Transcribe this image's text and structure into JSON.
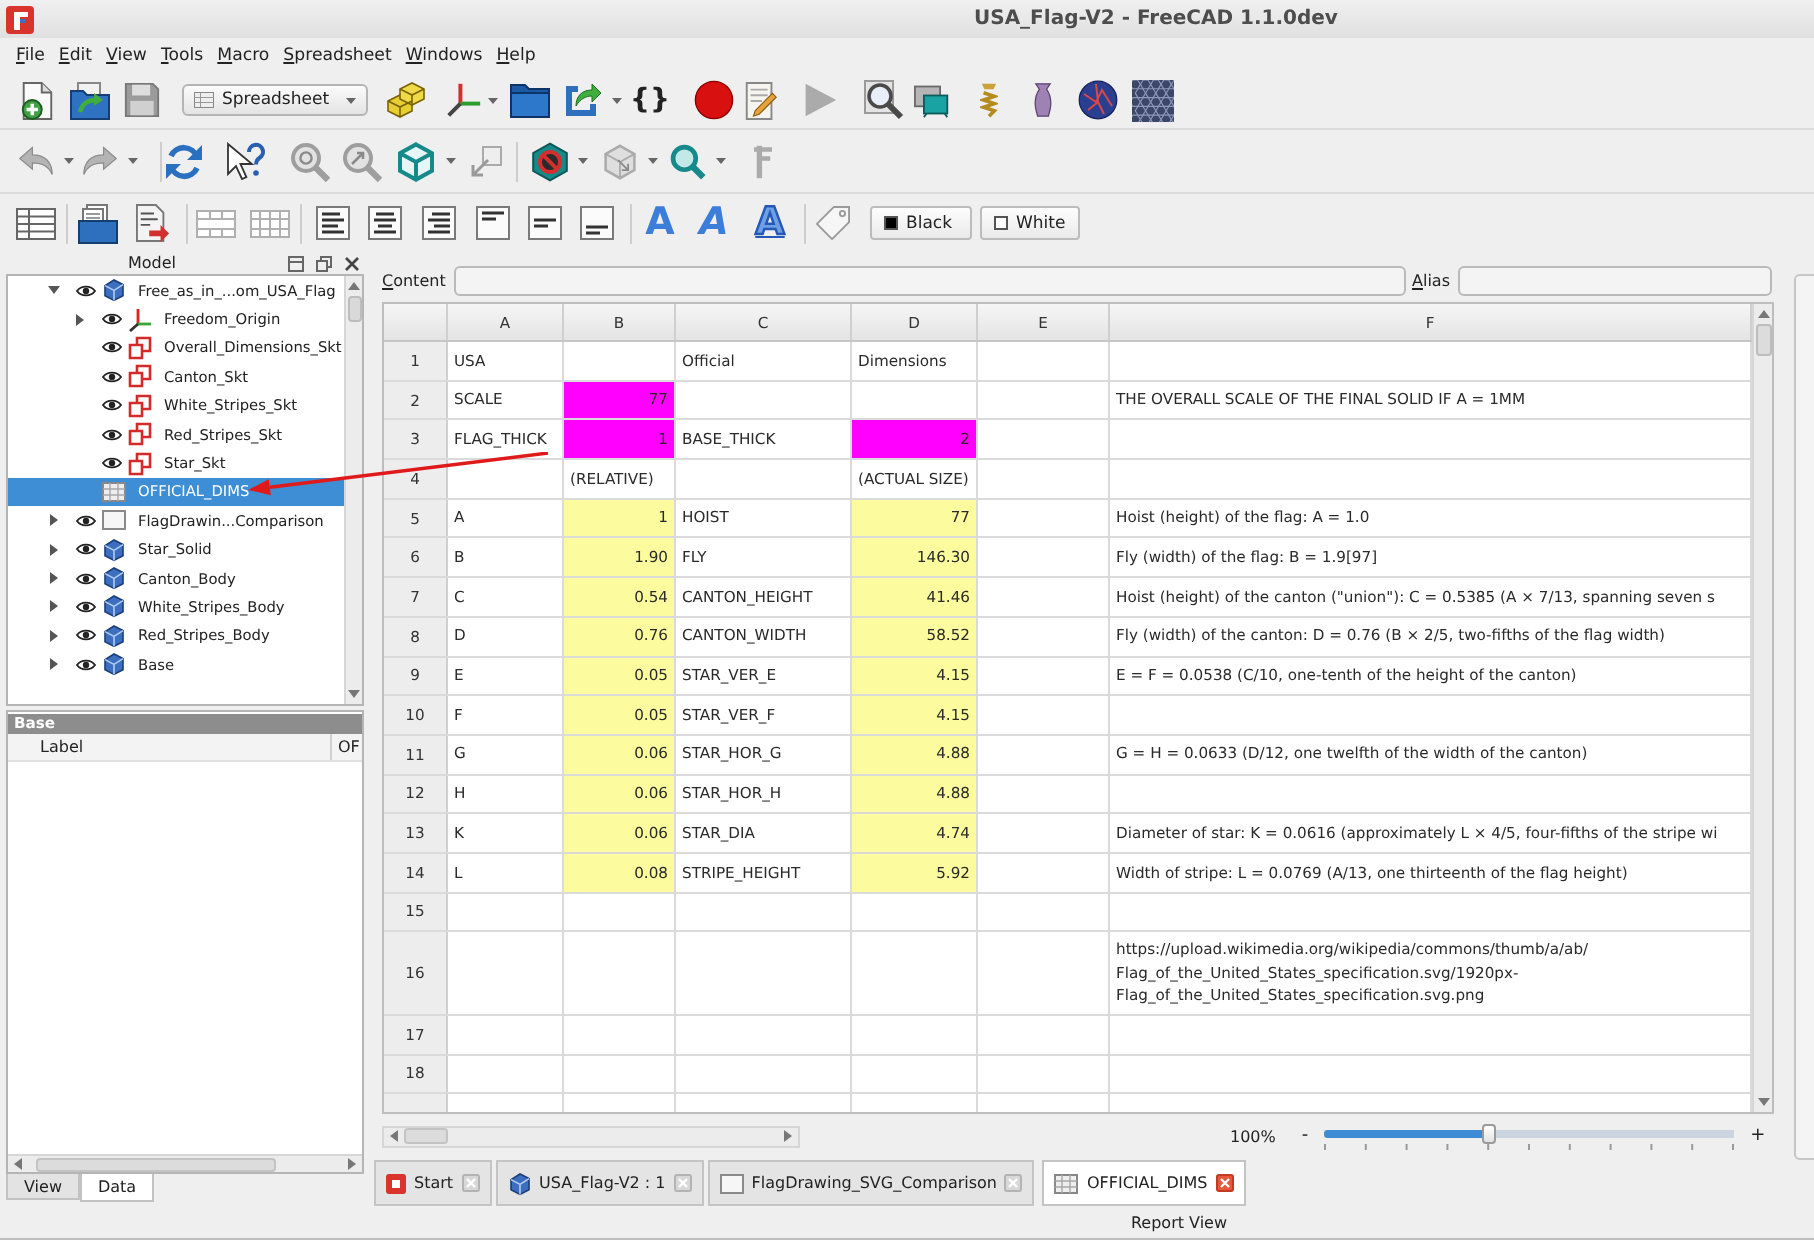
{
  "window": {
    "title": "USA_Flag-V2 - FreeCAD 1.1.0dev"
  },
  "menu_bar": [
    "File",
    "Edit",
    "View",
    "Tools",
    "Macro",
    "Spreadsheet",
    "Windows",
    "Help"
  ],
  "toolbar": {
    "workbench": "Spreadsheet",
    "braces_button": "{}",
    "format_buttons": [
      {
        "glyph": "A",
        "kind": "bold"
      },
      {
        "glyph": "A",
        "kind": "italic"
      },
      {
        "glyph": "A",
        "kind": "underline"
      }
    ],
    "color_buttons": [
      {
        "label": "Black",
        "color": "#000000"
      },
      {
        "label": "White",
        "color": "#ffffff"
      }
    ]
  },
  "model_panel": {
    "title": "Model",
    "tree": [
      {
        "label": "Free_as_in_...om_USA_Flag",
        "kind": "body",
        "visible": true,
        "expanded": true,
        "selected": false,
        "children": [
          {
            "label": "Freedom_Origin",
            "kind": "origin",
            "visible": true,
            "expanded": false,
            "selected": false
          },
          {
            "label": "Overall_Dimensions_Skt",
            "kind": "sketch",
            "visible": true,
            "selected": false
          },
          {
            "label": "Canton_Skt",
            "kind": "sketch",
            "visible": true,
            "selected": false
          },
          {
            "label": "White_Stripes_Skt",
            "kind": "sketch",
            "visible": true,
            "selected": false
          },
          {
            "label": "Red_Stripes_Skt",
            "kind": "sketch",
            "visible": true,
            "selected": false
          },
          {
            "label": "Star_Skt",
            "kind": "sketch",
            "visible": true,
            "selected": false
          },
          {
            "label": "OFFICIAL_DIMS",
            "kind": "spreadsheet",
            "visible": false,
            "selected": true
          }
        ]
      },
      {
        "label": "FlagDrawin...Comparison",
        "kind": "page",
        "visible": true,
        "expanded": false,
        "selected": false
      },
      {
        "label": "Star_Solid",
        "kind": "body",
        "visible": true,
        "expanded": false,
        "selected": false
      },
      {
        "label": "Canton_Body",
        "kind": "body",
        "visible": true,
        "expanded": false,
        "selected": false
      },
      {
        "label": "White_Stripes_Body",
        "kind": "body",
        "visible": true,
        "expanded": false,
        "selected": false
      },
      {
        "label": "Red_Stripes_Body",
        "kind": "body",
        "visible": true,
        "expanded": false,
        "selected": false
      },
      {
        "label": "Base",
        "kind": "body",
        "visible": true,
        "expanded": false,
        "selected": false
      }
    ]
  },
  "property_panel": {
    "group": "Base",
    "properties": [
      {
        "name": "Label",
        "value": "OF"
      }
    ],
    "tabs": [
      {
        "label": "View",
        "selected": false
      },
      {
        "label": "Data",
        "selected": true
      }
    ]
  },
  "spreadsheet": {
    "content_label": "Content",
    "alias_label": "Alias",
    "columns": [
      "A",
      "B",
      "C",
      "D",
      "E",
      "F"
    ],
    "rows": [
      {
        "header": "1",
        "cells": [
          {
            "text": "USA",
            "kind": "text"
          },
          null,
          {
            "text": "Official",
            "kind": "text"
          },
          {
            "text": "Dimensions",
            "kind": "text"
          },
          null,
          null
        ]
      },
      {
        "header": "2",
        "cells": [
          {
            "text": "SCALE",
            "kind": "text"
          },
          {
            "text": "77",
            "kind": "number",
            "color": "#ff00ff"
          },
          null,
          null,
          null,
          {
            "text": "THE OVERALL SCALE OF THE FINAL SOLID IF A = 1MM",
            "kind": "text"
          }
        ]
      },
      {
        "header": "3",
        "cells": [
          {
            "text": "FLAG_THICK",
            "kind": "text"
          },
          {
            "text": "1",
            "kind": "number",
            "color": "#ff00ff"
          },
          {
            "text": "BASE_THICK",
            "kind": "text"
          },
          {
            "text": "2",
            "kind": "number",
            "color": "#ff00ff"
          },
          null,
          null
        ]
      },
      {
        "header": "4",
        "cells": [
          null,
          {
            "text": "(RELATIVE)",
            "kind": "text"
          },
          null,
          {
            "text": "(ACTUAL SIZE)",
            "kind": "text"
          },
          null,
          null
        ]
      },
      {
        "header": "5",
        "cells": [
          {
            "text": "A",
            "kind": "text"
          },
          {
            "text": "1",
            "kind": "number",
            "color": "#fcfc9e"
          },
          {
            "text": "HOIST",
            "kind": "text"
          },
          {
            "text": "77",
            "kind": "number",
            "color": "#fcfc9e"
          },
          null,
          {
            "text": "Hoist (height) of the flag: A = 1.0",
            "kind": "text"
          }
        ]
      },
      {
        "header": "6",
        "cells": [
          {
            "text": "B",
            "kind": "text"
          },
          {
            "text": "1.90",
            "kind": "number",
            "color": "#fcfc9e"
          },
          {
            "text": "FLY",
            "kind": "text"
          },
          {
            "text": "146.30",
            "kind": "number",
            "color": "#fcfc9e"
          },
          null,
          {
            "text": "Fly (width) of the flag: B = 1.9[97]",
            "kind": "text"
          }
        ]
      },
      {
        "header": "7",
        "cells": [
          {
            "text": "C",
            "kind": "text"
          },
          {
            "text": "0.54",
            "kind": "number",
            "color": "#fcfc9e"
          },
          {
            "text": "CANTON_HEIGHT",
            "kind": "text"
          },
          {
            "text": "41.46",
            "kind": "number",
            "color": "#fcfc9e"
          },
          null,
          {
            "text": "Hoist (height) of the canton (\"union\"): C = 0.5385 (A × 7/13, spanning seven s",
            "kind": "text"
          }
        ]
      },
      {
        "header": "8",
        "cells": [
          {
            "text": "D",
            "kind": "text"
          },
          {
            "text": "0.76",
            "kind": "number",
            "color": "#fcfc9e"
          },
          {
            "text": "CANTON_WIDTH",
            "kind": "text"
          },
          {
            "text": "58.52",
            "kind": "number",
            "color": "#fcfc9e"
          },
          null,
          {
            "text": "Fly (width) of the canton: D = 0.76 (B × 2/5, two-fifths of the flag width)",
            "kind": "text"
          }
        ]
      },
      {
        "header": "9",
        "cells": [
          {
            "text": "E",
            "kind": "text"
          },
          {
            "text": "0.05",
            "kind": "number",
            "color": "#fcfc9e"
          },
          {
            "text": "STAR_VER_E",
            "kind": "text"
          },
          {
            "text": "4.15",
            "kind": "number",
            "color": "#fcfc9e"
          },
          null,
          {
            "text": "E = F = 0.0538 (C/10, one-tenth of the height of the canton)",
            "kind": "text"
          }
        ]
      },
      {
        "header": "10",
        "cells": [
          {
            "text": "F",
            "kind": "text"
          },
          {
            "text": "0.05",
            "kind": "number",
            "color": "#fcfc9e"
          },
          {
            "text": "STAR_VER_F",
            "kind": "text"
          },
          {
            "text": "4.15",
            "kind": "number",
            "color": "#fcfc9e"
          },
          null,
          null
        ]
      },
      {
        "header": "11",
        "cells": [
          {
            "text": "G",
            "kind": "text"
          },
          {
            "text": "0.06",
            "kind": "number",
            "color": "#fcfc9e"
          },
          {
            "text": "STAR_HOR_G",
            "kind": "text"
          },
          {
            "text": "4.88",
            "kind": "number",
            "color": "#fcfc9e"
          },
          null,
          {
            "text": "G = H = 0.0633 (D/12, one twelfth of the width of the canton)",
            "kind": "text"
          }
        ]
      },
      {
        "header": "12",
        "cells": [
          {
            "text": "H",
            "kind": "text"
          },
          {
            "text": "0.06",
            "kind": "number",
            "color": "#fcfc9e"
          },
          {
            "text": "STAR_HOR_H",
            "kind": "text"
          },
          {
            "text": "4.88",
            "kind": "number",
            "color": "#fcfc9e"
          },
          null,
          null
        ]
      },
      {
        "header": "13",
        "cells": [
          {
            "text": "K",
            "kind": "text"
          },
          {
            "text": "0.06",
            "kind": "number",
            "color": "#fcfc9e"
          },
          {
            "text": "STAR_DIA",
            "kind": "text"
          },
          {
            "text": "4.74",
            "kind": "number",
            "color": "#fcfc9e"
          },
          null,
          {
            "text": "Diameter of star: K = 0.0616 (approximately L × 4/5, four-fifths of the stripe wi",
            "kind": "text"
          }
        ]
      },
      {
        "header": "14",
        "cells": [
          {
            "text": "L",
            "kind": "text"
          },
          {
            "text": "0.08",
            "kind": "number",
            "color": "#fcfc9e"
          },
          {
            "text": "STRIPE_HEIGHT",
            "kind": "text"
          },
          {
            "text": "5.92",
            "kind": "number",
            "color": "#fcfc9e"
          },
          null,
          {
            "text": "Width of stripe: L = 0.0769 (A/13, one thirteenth of the flag height)",
            "kind": "text"
          }
        ]
      },
      {
        "header": "15"
      },
      {
        "header": "16",
        "cells": [
          null,
          null,
          null,
          null,
          null,
          {
            "text": "https://upload.wikimedia.org/wikipedia/commons/thumb/a/ab/\nFlag_of_the_United_States_specification.svg/1920px-\nFlag_of_the_United_States_specification.svg.png",
            "kind": "text"
          }
        ]
      },
      {
        "header": "17"
      },
      {
        "header": "18"
      }
    ]
  },
  "zoom": {
    "reading": "100%",
    "decrease": "-",
    "increase": "+",
    "level": 0.4
  },
  "document_tabs": [
    {
      "label": "Start",
      "kind": "start",
      "selected": false
    },
    {
      "label": "USA_Flag-V2 : 1",
      "kind": "view3d",
      "selected": false
    },
    {
      "label": "FlagDrawing_SVG_Comparison",
      "kind": "page",
      "selected": false
    },
    {
      "label": "OFFICIAL_DIMS",
      "kind": "spreadsheet",
      "selected": true
    }
  ],
  "report_view": {
    "title": "Report View"
  }
}
